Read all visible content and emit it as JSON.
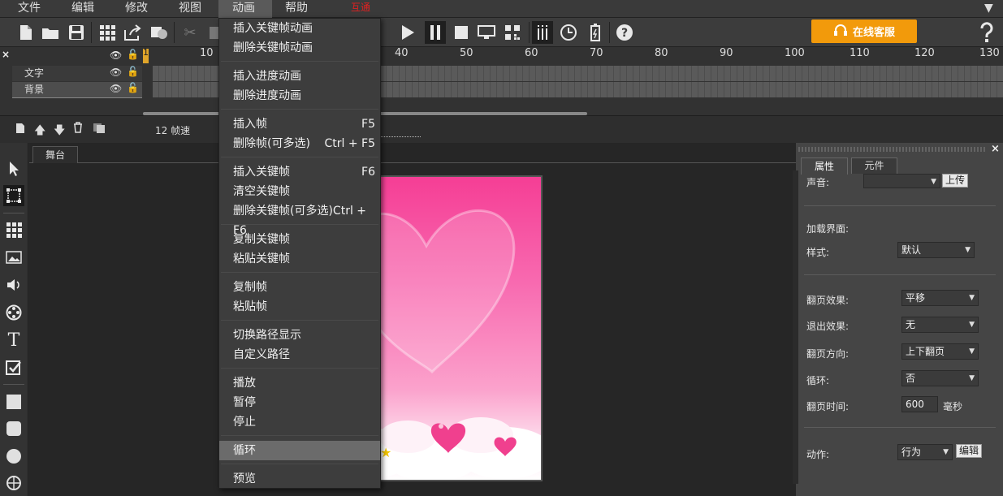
{
  "menubar": {
    "items": [
      "文件",
      "编辑",
      "修改",
      "视图",
      "动画",
      "帮助"
    ],
    "extra_label": "互通"
  },
  "toolbar": {
    "service_button": "在线客服",
    "help_icon": "?"
  },
  "timeline": {
    "ruler": [
      "1",
      "10",
      "40",
      "50",
      "60",
      "70",
      "80",
      "90",
      "100",
      "110",
      "120",
      "130"
    ],
    "layers": [
      "文字",
      "背景"
    ],
    "fps_label": "12 帧速"
  },
  "stage": {
    "tab_label": "舞台"
  },
  "properties": {
    "tabs": [
      "属性",
      "元件"
    ],
    "sound_label": "声音:",
    "upload_button": "上传",
    "loading_label": "加载界面:",
    "style_label": "样式:",
    "style_value": "默认",
    "transition_label": "翻页效果:",
    "transition_value": "平移",
    "exit_label": "退出效果:",
    "exit_value": "无",
    "direction_label": "翻页方向:",
    "direction_value": "上下翻页",
    "loop_label": "循环:",
    "loop_value": "否",
    "time_label": "翻页时间:",
    "time_value": "600",
    "time_unit": "毫秒",
    "action_label": "动作:",
    "action_value": "行为",
    "edit_button": "编辑"
  },
  "dropdown": {
    "items": [
      {
        "label": "插入关键帧动画",
        "shortcut": ""
      },
      {
        "label": "删除关键帧动画",
        "shortcut": ""
      },
      {
        "label": "插入进度动画",
        "shortcut": ""
      },
      {
        "label": "删除进度动画",
        "shortcut": ""
      },
      {
        "label": "插入帧",
        "shortcut": "F5"
      },
      {
        "label": "删除帧(可多选)",
        "shortcut": "Ctrl + F5"
      },
      {
        "label": "插入关键帧",
        "shortcut": "F6"
      },
      {
        "label": "清空关键帧",
        "shortcut": ""
      },
      {
        "label": "删除关键帧(可多选)Ctrl + F6",
        "shortcut": ""
      },
      {
        "label": "复制关键帧",
        "shortcut": ""
      },
      {
        "label": "粘贴关键帧",
        "shortcut": ""
      },
      {
        "label": "复制帧",
        "shortcut": ""
      },
      {
        "label": "粘贴帧",
        "shortcut": ""
      },
      {
        "label": "切换路径显示",
        "shortcut": ""
      },
      {
        "label": "自定义路径",
        "shortcut": ""
      },
      {
        "label": "播放",
        "shortcut": ""
      },
      {
        "label": "暂停",
        "shortcut": ""
      },
      {
        "label": "停止",
        "shortcut": ""
      },
      {
        "label": "循环",
        "shortcut": ""
      },
      {
        "label": "预览",
        "shortcut": ""
      }
    ],
    "highlighted": "循环"
  },
  "colors": {
    "accent": "#f29a0b",
    "stage_pink": "#f53e95",
    "menu_bg": "#3d3d3d"
  }
}
